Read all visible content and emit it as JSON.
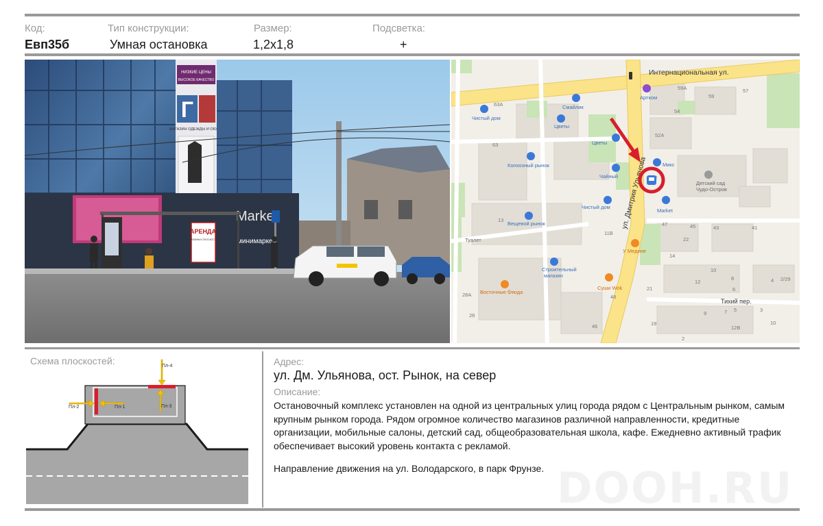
{
  "header": {
    "code_label": "Код:",
    "code_value": "Евп35б",
    "type_label": "Тип конструкции:",
    "type_value": "Умная остановка",
    "size_label": "Размер:",
    "size_value": "1,2х1,8",
    "light_label": "Подсветка:",
    "light_value": "+"
  },
  "photo": {
    "signs": {
      "floor1": "НИЗКИЕ ЦЕНЫ",
      "floor2": "ВЫСОКОЕ КАЧЕСТВО",
      "shop": "МАГАЗИН ОДЕЖДЫ И ОБУВИ",
      "big_letter": "Г",
      "market": "Market",
      "minimarket": "минимаркет",
      "rent": "АРЕНДА",
      "rent_sub": "РЕКЛАМНЫХ ПЛОСКОСТЕЙ"
    }
  },
  "map": {
    "streets": {
      "intl": "Интернациональная ул.",
      "dmitry": "ул. Дмитрия Ульянова",
      "tihiy": "Тихий пер."
    },
    "places": {
      "smile": "Смайлик",
      "chisty1": "Чистый дом",
      "tsvety1": "Цветы",
      "tsvety2": "Цветы",
      "kolkhoz": "Колхозный рынок",
      "chayny": "Чайный",
      "miks": "Микс",
      "market": "Market",
      "artkom": "Артком",
      "kindergarten1": "Детский сад",
      "kindergarten2": "Чудо-Остров",
      "chisty2": "Чистый дом",
      "veshevoy": "Вещевой рынок",
      "toilet": "Туалет",
      "umedine": "У Медине",
      "stroy1": "Строительный",
      "stroy2": "магазин",
      "sushi": "Суши Wok",
      "vostochnye": "Восточные блюда"
    },
    "numbers": [
      "59А",
      "59",
      "57",
      "54",
      "52А",
      "52",
      "63А",
      "63",
      "13",
      "11В",
      "47",
      "45",
      "43",
      "41",
      "22",
      "14",
      "10",
      "12",
      "8",
      "6",
      "4",
      "2/29",
      "9",
      "7",
      "5",
      "3",
      "10",
      "12В",
      "21",
      "19",
      "46",
      "48",
      "28А",
      "28",
      "2"
    ]
  },
  "scheme": {
    "title": "Схема плоскостей:",
    "labels": {
      "p1": "Пл-1",
      "p2": "Пл-2",
      "p3": "Пл-3",
      "p4": "Пл-4"
    }
  },
  "address": {
    "label": "Адрес:",
    "value": "ул. Дм. Ульянова, ост. Рынок, на север"
  },
  "description": {
    "label": "Описание:",
    "text": "Остановочный комплекс установлен на одной из центральных улиц города рядом с Центральным рынком, самым крупным рынком города. Рядом огромное количество магазинов различной направленности, кредитные организации, мобильные салоны, детский сад, общеобразовательная школа, кафе. Ежедневно активный трафик обеспечивает высокий уровень контакта с рекламой.",
    "direction": "Направление движения на ул. Володарского, в парк Фрунзе."
  },
  "watermark": "DOOH.RU",
  "colors": {
    "rule": "#9a9a9a",
    "marker": "#d81e2c",
    "arrow": "#f2c200",
    "plane": "#d81e2c"
  }
}
